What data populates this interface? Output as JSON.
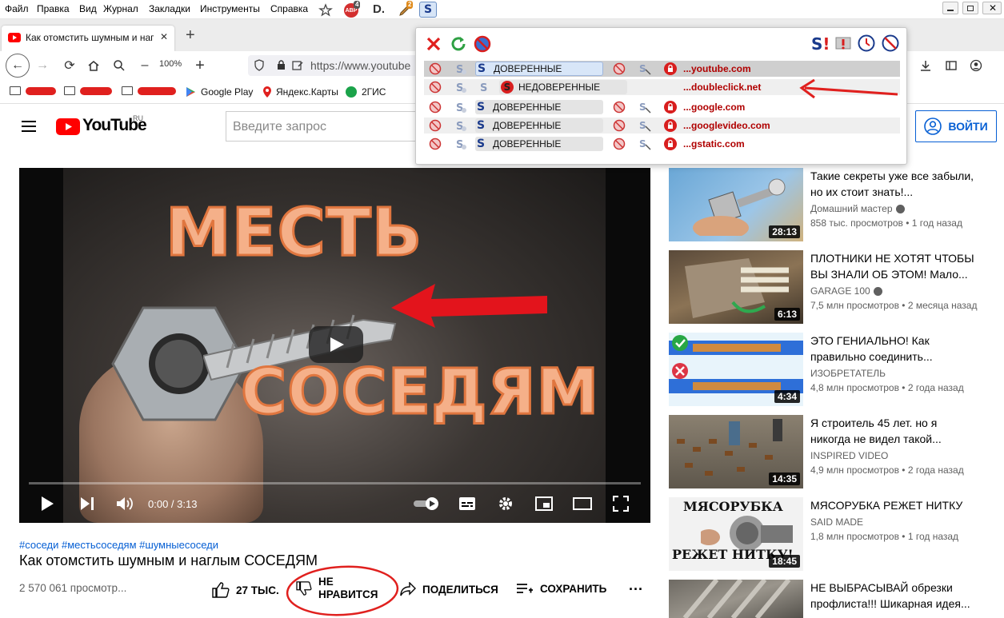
{
  "menubar": {
    "items": [
      "Файл",
      "Правка",
      "Вид",
      "Журнал",
      "Закладки",
      "Инструменты",
      "Справка"
    ],
    "ext_badges": {
      "abp_count": "4",
      "ext2_count": "2"
    },
    "ext_labels": {
      "abp": "ABP",
      "d": "D."
    }
  },
  "tab": {
    "title": "Как отомстить шумным и наг",
    "close": "✕",
    "new_tab": "+"
  },
  "navbar": {
    "zoom": "100%",
    "url": "https://www.youtube"
  },
  "bookmarks": [
    {
      "label": "Google Play",
      "icon": "google-play-icon"
    },
    {
      "label": "Яндекс.Карты",
      "icon": "map-pin-icon"
    },
    {
      "label": "2ГИС",
      "icon": "2gis-icon"
    }
  ],
  "youtube": {
    "logo_text": "YouTube",
    "logo_region": "RU",
    "search_placeholder": "Введите запрос",
    "login": "ВОЙТИ"
  },
  "video": {
    "overlay_line1": "МЕСТЬ",
    "overlay_line2": "СОСЕДЯМ",
    "time": "0:00 / 3:13",
    "progress": 0
  },
  "video_info": {
    "hashtags": "#соседи #местьсоседям #шумныесоседи",
    "title": "Как отомстить шумным и наглым СОСЕДЯМ",
    "views": "2 570 061 просмотр...",
    "likes": "27 ТЫС.",
    "dislike_line1": "НЕ",
    "dislike_line2": "НРАВИТСЯ",
    "share": "ПОДЕЛИТЬСЯ",
    "save": "СОХРАНИТЬ",
    "more": "..."
  },
  "recommendations": [
    {
      "title": "Такие секреты уже все забыли, но их стоит знать!...",
      "channel": "Домашний мастер",
      "verified": true,
      "views": "858 тыс. просмотров",
      "age": "1 год назад",
      "duration": "28:13"
    },
    {
      "title": "ПЛОТНИКИ НЕ ХОТЯТ ЧТОБЫ ВЫ ЗНАЛИ ОБ ЭТОМ! Мало...",
      "channel": "GARAGE 100",
      "verified": true,
      "views": "7,5 млн просмотров",
      "age": "2 месяца назад",
      "duration": "6:13"
    },
    {
      "title": "ЭТО ГЕНИАЛЬНО! Как правильно соединить...",
      "channel": "ИЗОБРЕТАТЕЛЬ",
      "verified": false,
      "views": "4,8 млн просмотров",
      "age": "2 года назад",
      "duration": "4:34"
    },
    {
      "title": "Я строитель 45 лет. но я никогда не видел такой...",
      "channel": "INSPIRED VIDEO",
      "verified": false,
      "views": "4,9 млн просмотров",
      "age": "2 года назад",
      "duration": "14:35"
    },
    {
      "title": "МЯСОРУБКА РЕЖЕТ НИТКУ",
      "channel": "SAID MADE",
      "verified": false,
      "views": "1,8 млн просмотров",
      "age": "1 год назад",
      "duration": "18:45",
      "thumb_text_top": "МЯСОРУБКА",
      "thumb_text_bottom": "РЕЖЕТ НИТКУ!"
    },
    {
      "title": "НЕ ВЫБРАСЫВАЙ обрезки профлиста!!! Шикарная идея...",
      "channel": "",
      "verified": false,
      "views": "",
      "age": "",
      "duration": ""
    }
  ],
  "popup": {
    "rows": [
      {
        "trust": "ДОВЕРЕННЫЕ",
        "trusted": true,
        "domain": "...youtube.com"
      },
      {
        "trust": "НЕДОВЕРЕННЫЕ",
        "trusted": false,
        "domain": "...doubleclick.net"
      },
      {
        "trust": "ДОВЕРЕННЫЕ",
        "trusted": true,
        "domain": "...google.com"
      },
      {
        "trust": "ДОВЕРЕННЫЕ",
        "trusted": true,
        "domain": "...googlevideo.com"
      },
      {
        "trust": "ДОВЕРЕННЫЕ",
        "trusted": true,
        "domain": "...gstatic.com"
      }
    ]
  },
  "colors": {
    "accent_red": "#e0201e",
    "youtube_red": "#ff0000",
    "link_blue": "#065fd4",
    "domain_red": "#b00000"
  }
}
